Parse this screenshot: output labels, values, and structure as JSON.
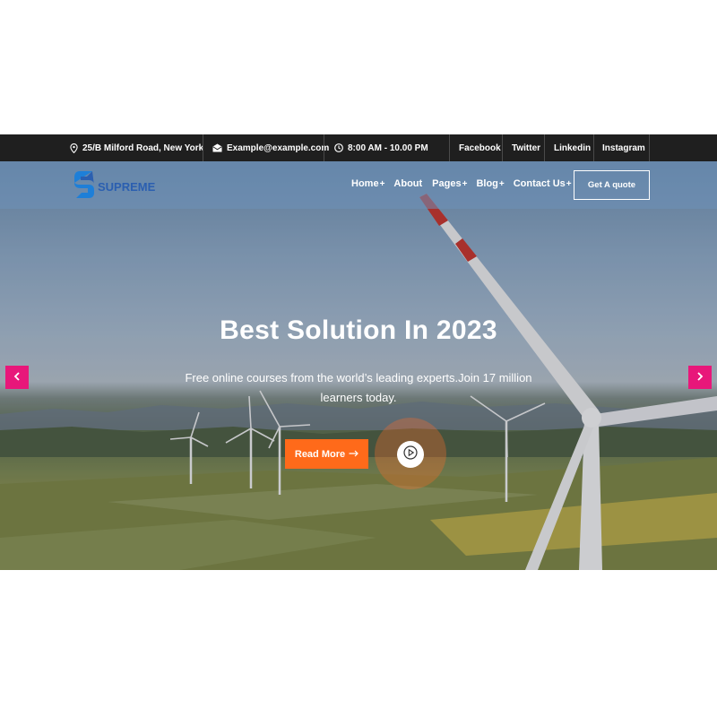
{
  "topbar": {
    "address": "25/B Milford Road, New York",
    "email": "Example@example.com",
    "hours": "8:00 AM - 10.00 PM",
    "social": [
      "Facebook",
      "Twitter",
      "Linkedin",
      "Instagram"
    ]
  },
  "nav": {
    "logo_text": "SUPREME",
    "links": [
      {
        "label": "Home",
        "suffix": "+"
      },
      {
        "label": "About",
        "suffix": ""
      },
      {
        "label": "Pages",
        "suffix": "+"
      },
      {
        "label": "Blog",
        "suffix": "+"
      },
      {
        "label": "Contact Us",
        "suffix": "+"
      }
    ],
    "quote_button": "Get A quote"
  },
  "hero": {
    "title": "Best Solution In 2023",
    "subtitle": "Free online courses from the world’s leading experts.Join 17 million learners today.",
    "read_more": "Read More"
  },
  "colors": {
    "accent": "#ff6a1a",
    "slider_arrow": "#e8177a",
    "topbar_bg": "#1f1f1f",
    "logo_blue": "#2b5fb0"
  },
  "icons": {
    "address": "map-pin-icon",
    "email": "envelope-icon",
    "hours": "clock-icon",
    "read_more": "arrow-right-icon",
    "play": "play-icon",
    "prev": "chevron-left-icon",
    "next": "chevron-right-icon"
  }
}
